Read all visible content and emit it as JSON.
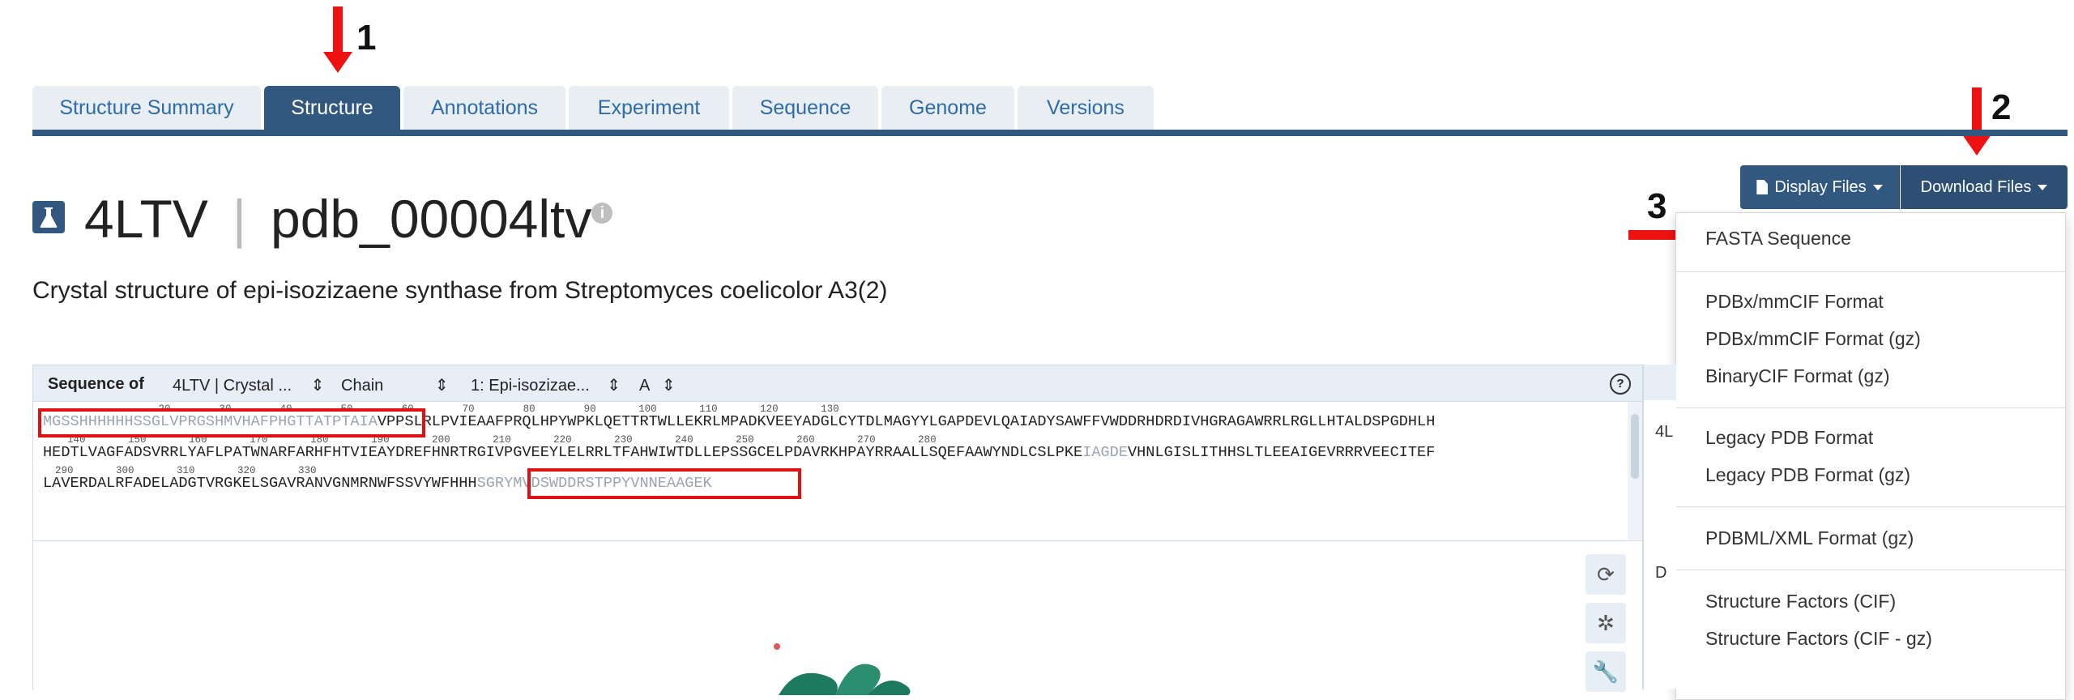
{
  "annotations": {
    "arrow1_label": "1",
    "arrow2_label": "2",
    "arrow3_label": "3",
    "arrow_color": "#ee1111"
  },
  "tabs": [
    {
      "label": "Structure Summary",
      "active": false
    },
    {
      "label": "Structure",
      "active": true
    },
    {
      "label": "Annotations",
      "active": false
    },
    {
      "label": "Experiment",
      "active": false
    },
    {
      "label": "Sequence",
      "active": false
    },
    {
      "label": "Genome",
      "active": false
    },
    {
      "label": "Versions",
      "active": false
    }
  ],
  "header": {
    "pdb_id": "4LTV",
    "separator": "|",
    "pdb_extended_id": "pdb_00004ltv",
    "info_glyph": "i",
    "subtitle": "Crystal structure of epi-isozizaene synthase from Streptomyces coelicolor A3(2)"
  },
  "buttons": {
    "display_files": "Display Files",
    "download_files": "Download Files"
  },
  "download_menu": {
    "items": [
      "FASTA Sequence",
      "PDBx/mmCIF Format",
      "PDBx/mmCIF Format (gz)",
      "BinaryCIF Format (gz)",
      "Legacy PDB Format",
      "Legacy PDB Format (gz)",
      "PDBML/XML Format (gz)",
      "Structure Factors (CIF)",
      "Structure Factors (CIF - gz)"
    ]
  },
  "viewer": {
    "bar": {
      "label": "Sequence of",
      "entry_select": "4LTV | Crystal ...",
      "chain_label": "Chain",
      "entity_select": "1: Epi-isozizae...",
      "chain_select": "A",
      "select_arrows": "⇕",
      "help": "?"
    },
    "sequence": {
      "row1_nums": "                   20        30        40        50        60        70        80        90       100       110       120       130",
      "row1_grey": "MGSSHHHHHHSSGLVPRGSHMVHAFPHGTTATPTAIA",
      "row1_black": "VPPSLRLPVIEAAFPRQLHPYWPKLQETTRTWLLEKRLMPADKVEEYADGLCYTDLMAGYYLGAPDEVLQAIADYSAWFFVWDDRHDRDIVHGRAGAWRRLRGLLHTALDSPGDHLH",
      "row2_nums": "    140       150       160       170       180       190       200       210       220       230       240       250       260       270       280",
      "row2_black_a": "HEDTLVAGFADSVRRLYAFLPATWNARFARHFHTVIEAYDREFHNRTRGIVPGVEEYLELRRLTFAHWIWTDLLEPSSGCELPDAVRKHPAYRRAALLSQEFAAWYNDLCSLPKE",
      "row2_grey": "IAGDE",
      "row2_black_b": "VHNLGISLITHHSLTLEEAIGEVRRRVEECITEF",
      "row3_nums": "  290       300       310       320       330",
      "row3_black": "LAVERDALRFADELADGTVRGKELSGAVRANVGNMRNWFSSVYWFHHH",
      "row3_grey": "SGRYMVDSWDDRSTPPYVNNEAAGEK"
    },
    "side_buttons": [
      "reset-icon",
      "spin-icon",
      "wrench-icon"
    ],
    "side_glyphs": [
      "⟳",
      "✲",
      "🔧"
    ],
    "right_panel_texts": [
      "4L",
      "D"
    ]
  },
  "colors": {
    "brand": "#325880",
    "tab_inactive_bg": "#e9eef3",
    "tab_inactive_text": "#2e6ba8",
    "highlight_box": "#e01010"
  }
}
